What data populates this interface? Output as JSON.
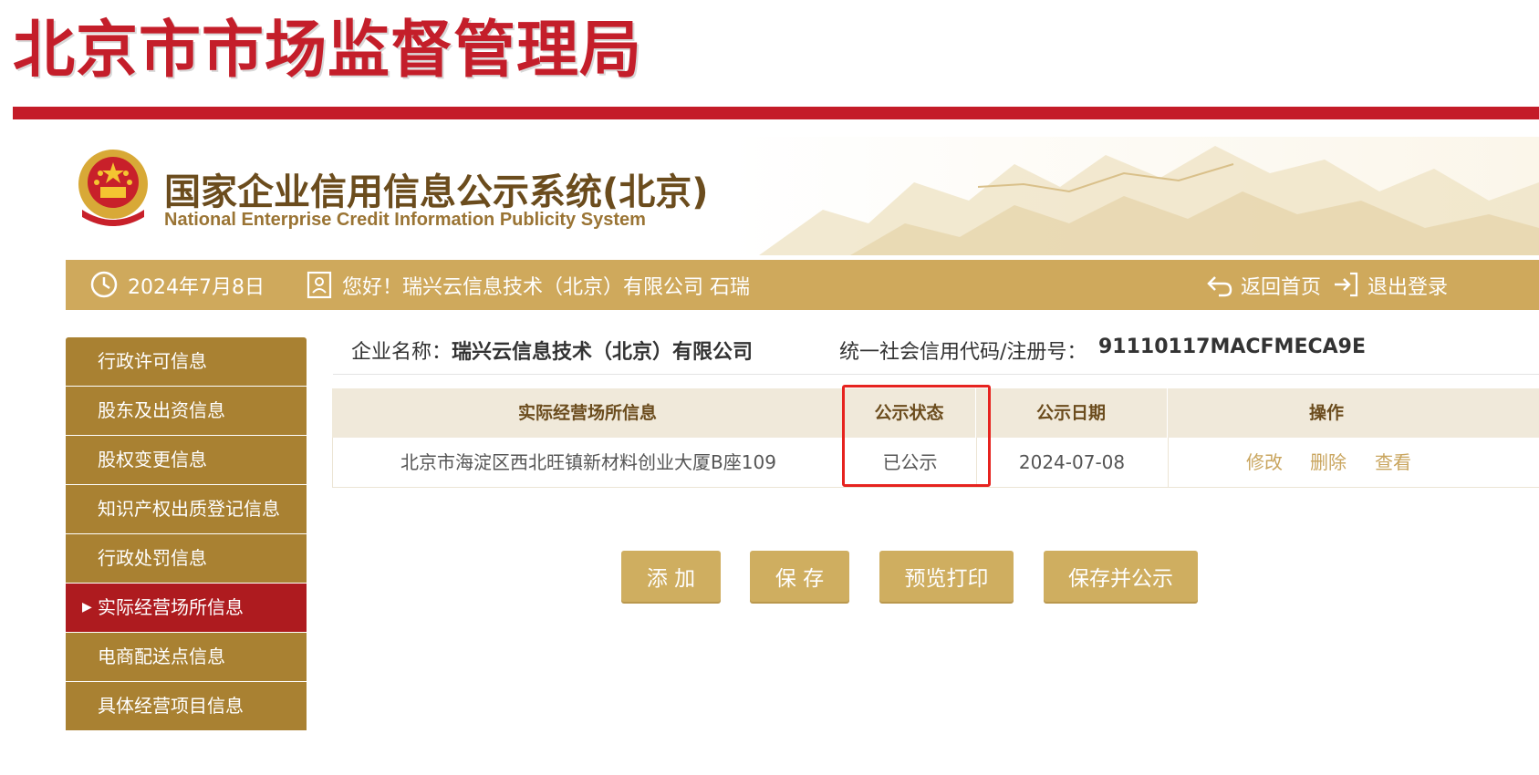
{
  "header": {
    "org_title": "北京市市场监督管理局",
    "system_title": "国家企业信用信息公示系统(北京)",
    "system_subtitle": "National Enterprise Credit Information Publicity System"
  },
  "infobar": {
    "date": "2024年7月8日",
    "greeting": "您好！瑞兴云信息技术（北京）有限公司  石瑞",
    "home_label": "返回首页",
    "logout_label": "退出登录"
  },
  "sidebar": {
    "items": [
      {
        "label": "行政许可信息",
        "active": false
      },
      {
        "label": "股东及出资信息",
        "active": false
      },
      {
        "label": "股权变更信息",
        "active": false
      },
      {
        "label": "知识产权出质登记信息",
        "active": false
      },
      {
        "label": "行政处罚信息",
        "active": false
      },
      {
        "label": "实际经营场所信息",
        "active": true
      },
      {
        "label": "电商配送点信息",
        "active": false
      },
      {
        "label": "具体经营项目信息",
        "active": false
      }
    ]
  },
  "company": {
    "name_label": "企业名称：",
    "name_value": "瑞兴云信息技术（北京）有限公司",
    "code_label": "统一社会信用代码/注册号：",
    "code_value": "91110117MACFMECA9E"
  },
  "table": {
    "headers": [
      "实际经营场所信息",
      "公示状态",
      "公示日期",
      "操作"
    ],
    "rows": [
      {
        "address": "北京市海淀区西北旺镇新材料创业大厦B座109",
        "status": "已公示",
        "date": "2024-07-08",
        "actions": [
          "修改",
          "删除",
          "查看"
        ]
      }
    ]
  },
  "buttons": {
    "add": "添 加",
    "save": "保 存",
    "preview": "预览打印",
    "save_publish": "保存并公示"
  },
  "colors": {
    "brand_red": "#c41e2a",
    "gold": "#cfa95c",
    "sidebar_brown": "#a98132",
    "active_red": "#ae1b1f",
    "highlight_red": "#e6231f"
  }
}
